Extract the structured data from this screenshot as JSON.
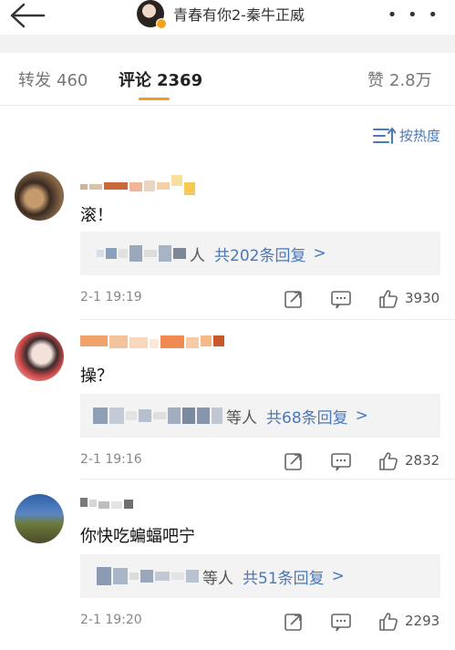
{
  "header": {
    "back_icon": "arrow-left-icon",
    "title": "青春有你2-秦牛正威",
    "more_icon": "more-dots-icon",
    "more_label": "• • •"
  },
  "tabs": [
    {
      "label": "转发",
      "count": "460"
    },
    {
      "label": "评论",
      "count": "2369"
    },
    {
      "label": "赞",
      "count": "2.8万"
    }
  ],
  "accent": "#f39a1f",
  "link_color": "#4a78b8",
  "sort": {
    "label": "按热度",
    "icon": "sort-icon"
  },
  "comments": [
    {
      "text": "滚！",
      "reply_label": "人",
      "reply_count": "共202条回复",
      "time": "2-1 19:19",
      "likes": "3930"
    },
    {
      "text": "操？",
      "reply_label": "等人",
      "reply_count": "共68条回复",
      "time": "2-1 19:16",
      "likes": "2832"
    },
    {
      "text": "你快吃蝙蝠吧宁",
      "reply_label": "等人",
      "reply_count": "共51条回复",
      "time": "2-1 19:20",
      "likes": "2293"
    }
  ],
  "reply_arrow": ">"
}
